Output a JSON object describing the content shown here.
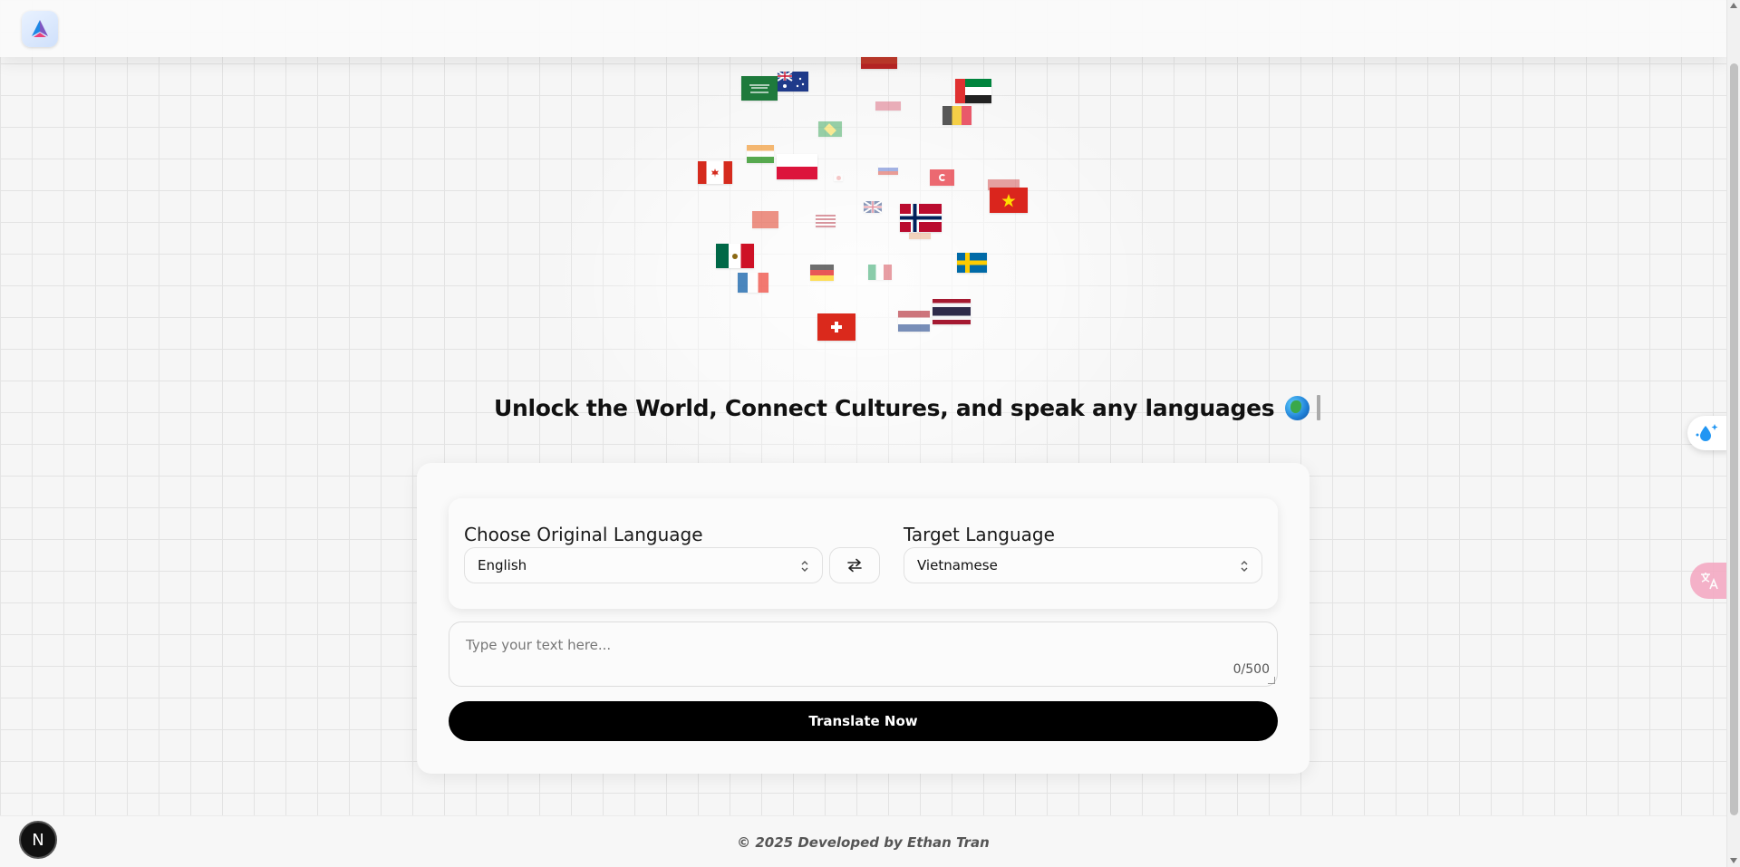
{
  "header": {
    "logo_icon": "app-logo-icon"
  },
  "hero": {
    "headline": "Unlock the World, Connect Cultures, and speak any languages",
    "headline_icon": "globe-emoji-icon"
  },
  "translator": {
    "source_label": "Choose Original Language",
    "source_value": "English",
    "target_label": "Target Language",
    "target_value": "Vietnamese",
    "swap_icon": "swap-arrows-icon",
    "input_placeholder": "Type your text here...",
    "char_counter": "0/500",
    "submit_label": "Translate Now"
  },
  "footer": {
    "text": "© 2025 Developed by Ethan Tran"
  },
  "floating": {
    "dev_badge_letter": "N",
    "side_button_1_icon": "water-drop-sparkle-icon",
    "side_button_2_icon": "translate-icon"
  },
  "flags": [
    "saudi-arabia",
    "australia",
    "uae",
    "belgium",
    "brazil",
    "india",
    "poland",
    "canada",
    "russia",
    "turkey",
    "vietnam",
    "china",
    "uk",
    "usa",
    "norway",
    "mexico",
    "germany",
    "italy",
    "sweden",
    "france",
    "netherlands",
    "thailand",
    "switzerland",
    "japan",
    "portugal",
    "indonesia"
  ],
  "colors": {
    "accent": "#000000",
    "background": "#f6f6f6",
    "card": "#fafafa"
  }
}
